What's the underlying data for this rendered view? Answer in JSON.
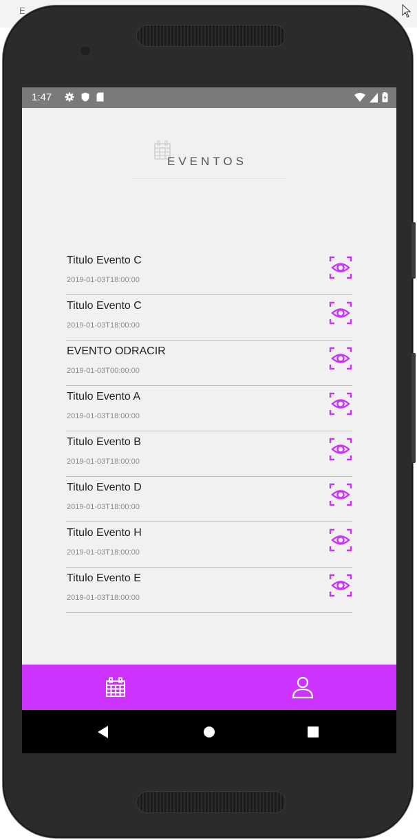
{
  "status_bar": {
    "time": "1:47"
  },
  "header": {
    "title": "EVENTOS"
  },
  "events": [
    {
      "title": "Titulo Evento C",
      "date": "2019-01-03T18:00:00"
    },
    {
      "title": "Titulo Evento C",
      "date": "2019-01-03T18:00:00"
    },
    {
      "title": "EVENTO ODRACIR",
      "date": "2019-01-03T00:00:00"
    },
    {
      "title": "Titulo Evento A",
      "date": "2019-01-03T18:00:00"
    },
    {
      "title": "Titulo Evento B",
      "date": "2019-01-03T18:00:00"
    },
    {
      "title": "Titulo Evento D",
      "date": "2019-01-03T18:00:00"
    },
    {
      "title": "Titulo Evento H",
      "date": "2019-01-03T18:00:00"
    },
    {
      "title": "Titulo Evento E",
      "date": "2019-01-03T18:00:00"
    }
  ],
  "icons": {
    "header": "calendar-icon",
    "row_action": "view-eye-icon",
    "nav_left": "calendar-icon",
    "nav_right": "user-icon",
    "system": [
      "back-icon",
      "home-icon",
      "recents-icon"
    ]
  },
  "colors": {
    "accent": "#cc33ff",
    "status_bar": "#7a7a7a",
    "screen_bg": "#f1f1f1",
    "nav_bar": "#000000"
  }
}
